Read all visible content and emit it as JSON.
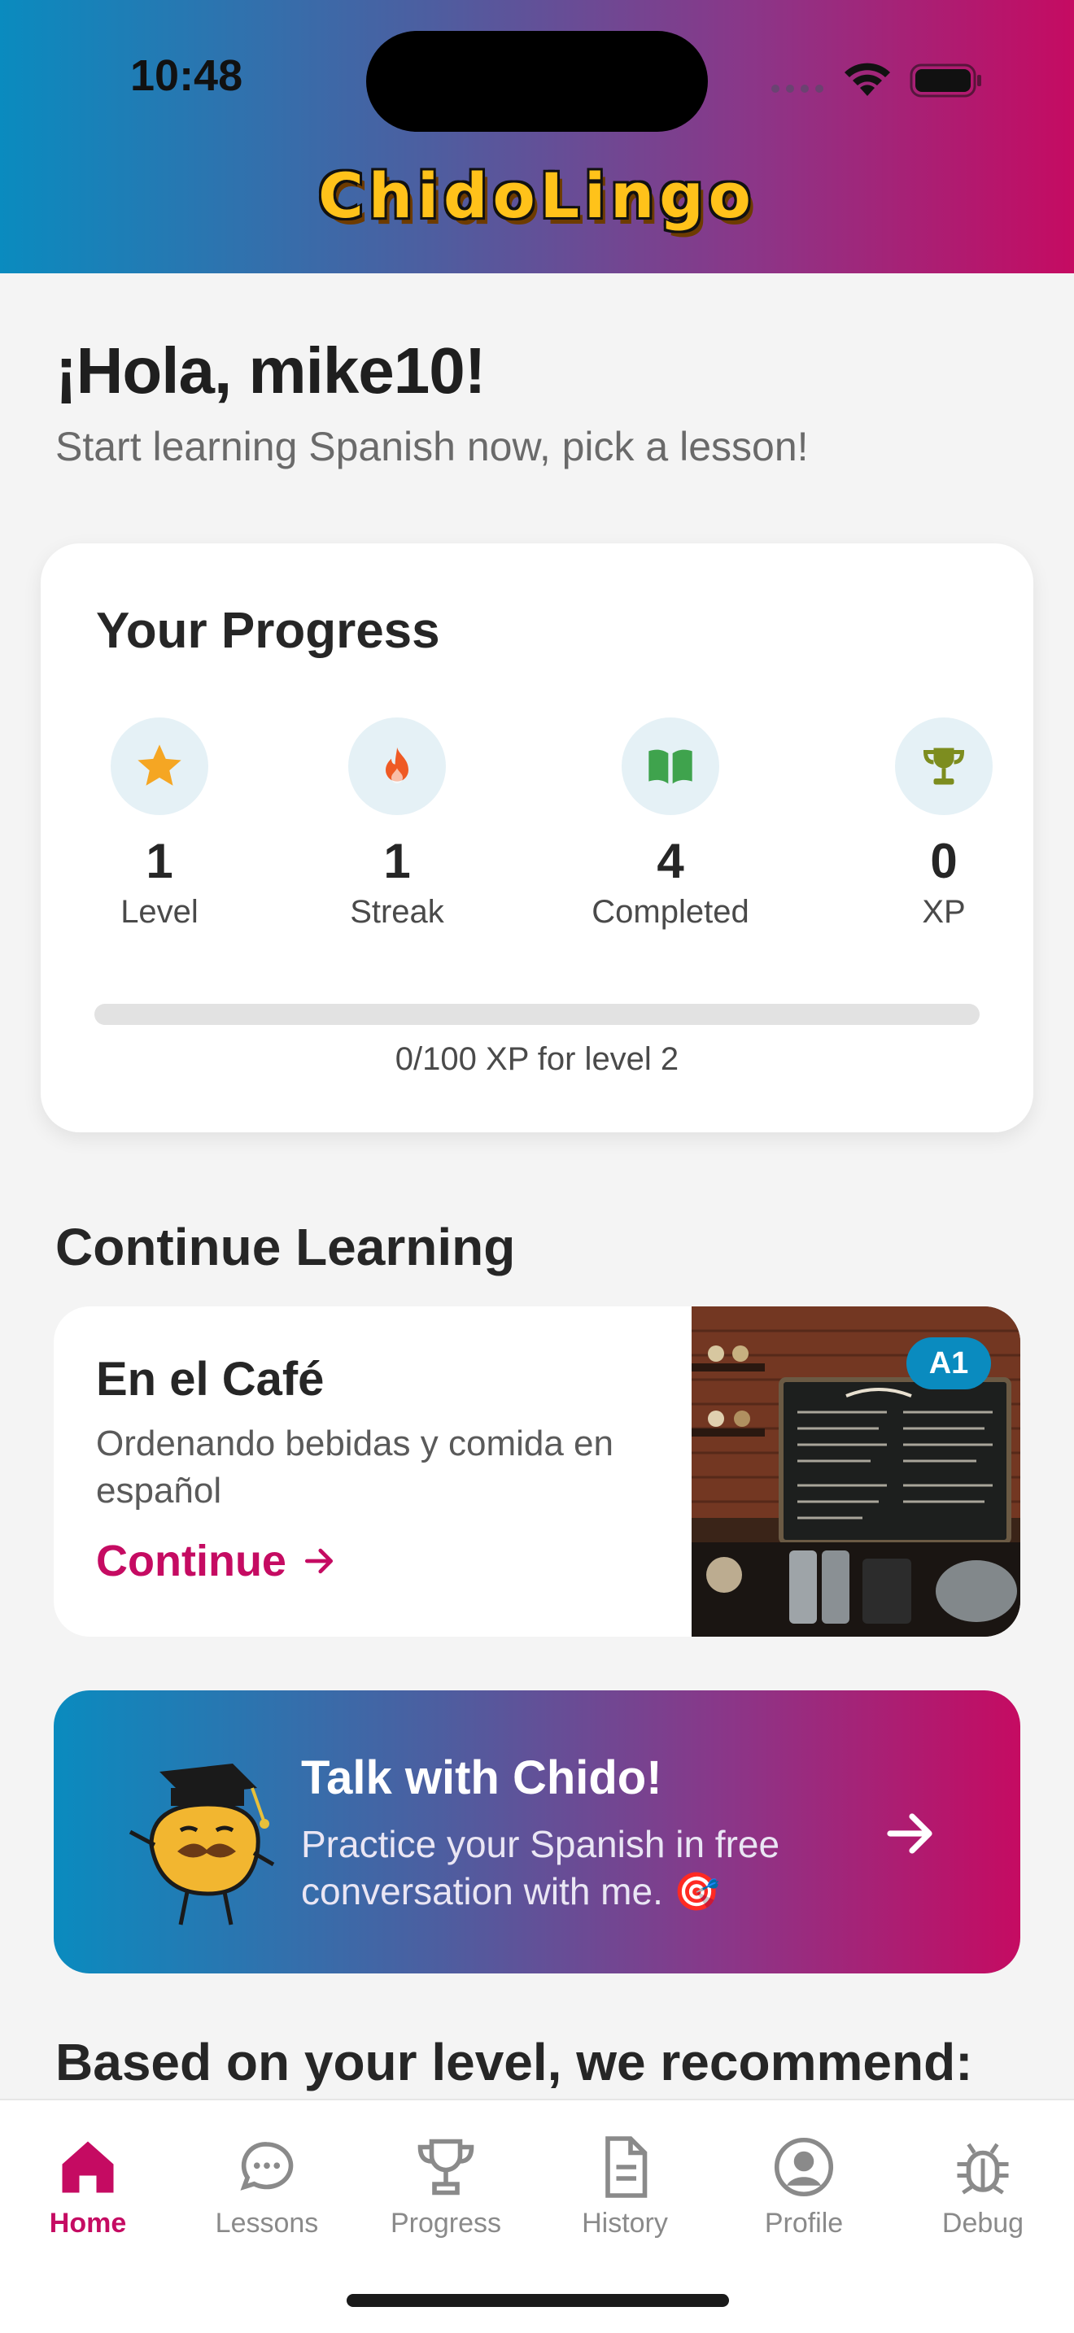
{
  "status_bar": {
    "time": "10:48"
  },
  "header": {
    "app_name": "ChidoLingo"
  },
  "greeting": {
    "title": "¡Hola, mike10!",
    "subtitle": "Start learning Spanish now, pick a lesson!"
  },
  "progress": {
    "title": "Your Progress",
    "stats": [
      {
        "icon": "star-icon",
        "value": "1",
        "label": "Level",
        "color": "#f5a623"
      },
      {
        "icon": "flame-icon",
        "value": "1",
        "label": "Streak",
        "color": "#ef5a24"
      },
      {
        "icon": "book-icon",
        "value": "4",
        "label": "Completed",
        "color": "#3fa34d"
      },
      {
        "icon": "trophy-icon",
        "value": "0",
        "label": "XP",
        "color": "#7d8d1f"
      }
    ],
    "xp_fraction": 0,
    "caption": "0/100 XP for level 2"
  },
  "continue_learning": {
    "title": "Continue Learning",
    "lesson": {
      "title": "En el Café",
      "description": "Ordenando bebidas y comida en español",
      "cta": "Continue",
      "level_badge": "A1",
      "image": "coffee-shop-photo"
    }
  },
  "chat_card": {
    "title": "Talk with Chido!",
    "description": "Practice your Spanish in free conversation with me. 🎯"
  },
  "recommend": {
    "title": "Based on your level, we recommend:"
  },
  "tabbar": {
    "tabs": [
      {
        "label": "Home",
        "icon": "home-icon",
        "active": true
      },
      {
        "label": "Lessons",
        "icon": "chat-bubble-icon",
        "active": false
      },
      {
        "label": "Progress",
        "icon": "trophy-icon",
        "active": false
      },
      {
        "label": "History",
        "icon": "document-icon",
        "active": false
      },
      {
        "label": "Profile",
        "icon": "person-icon",
        "active": false
      },
      {
        "label": "Debug",
        "icon": "bug-icon",
        "active": false
      }
    ]
  },
  "colors": {
    "accent": "#c50b62",
    "brand_blue": "#0a8bbf",
    "logo_yellow": "#ffc21a"
  }
}
